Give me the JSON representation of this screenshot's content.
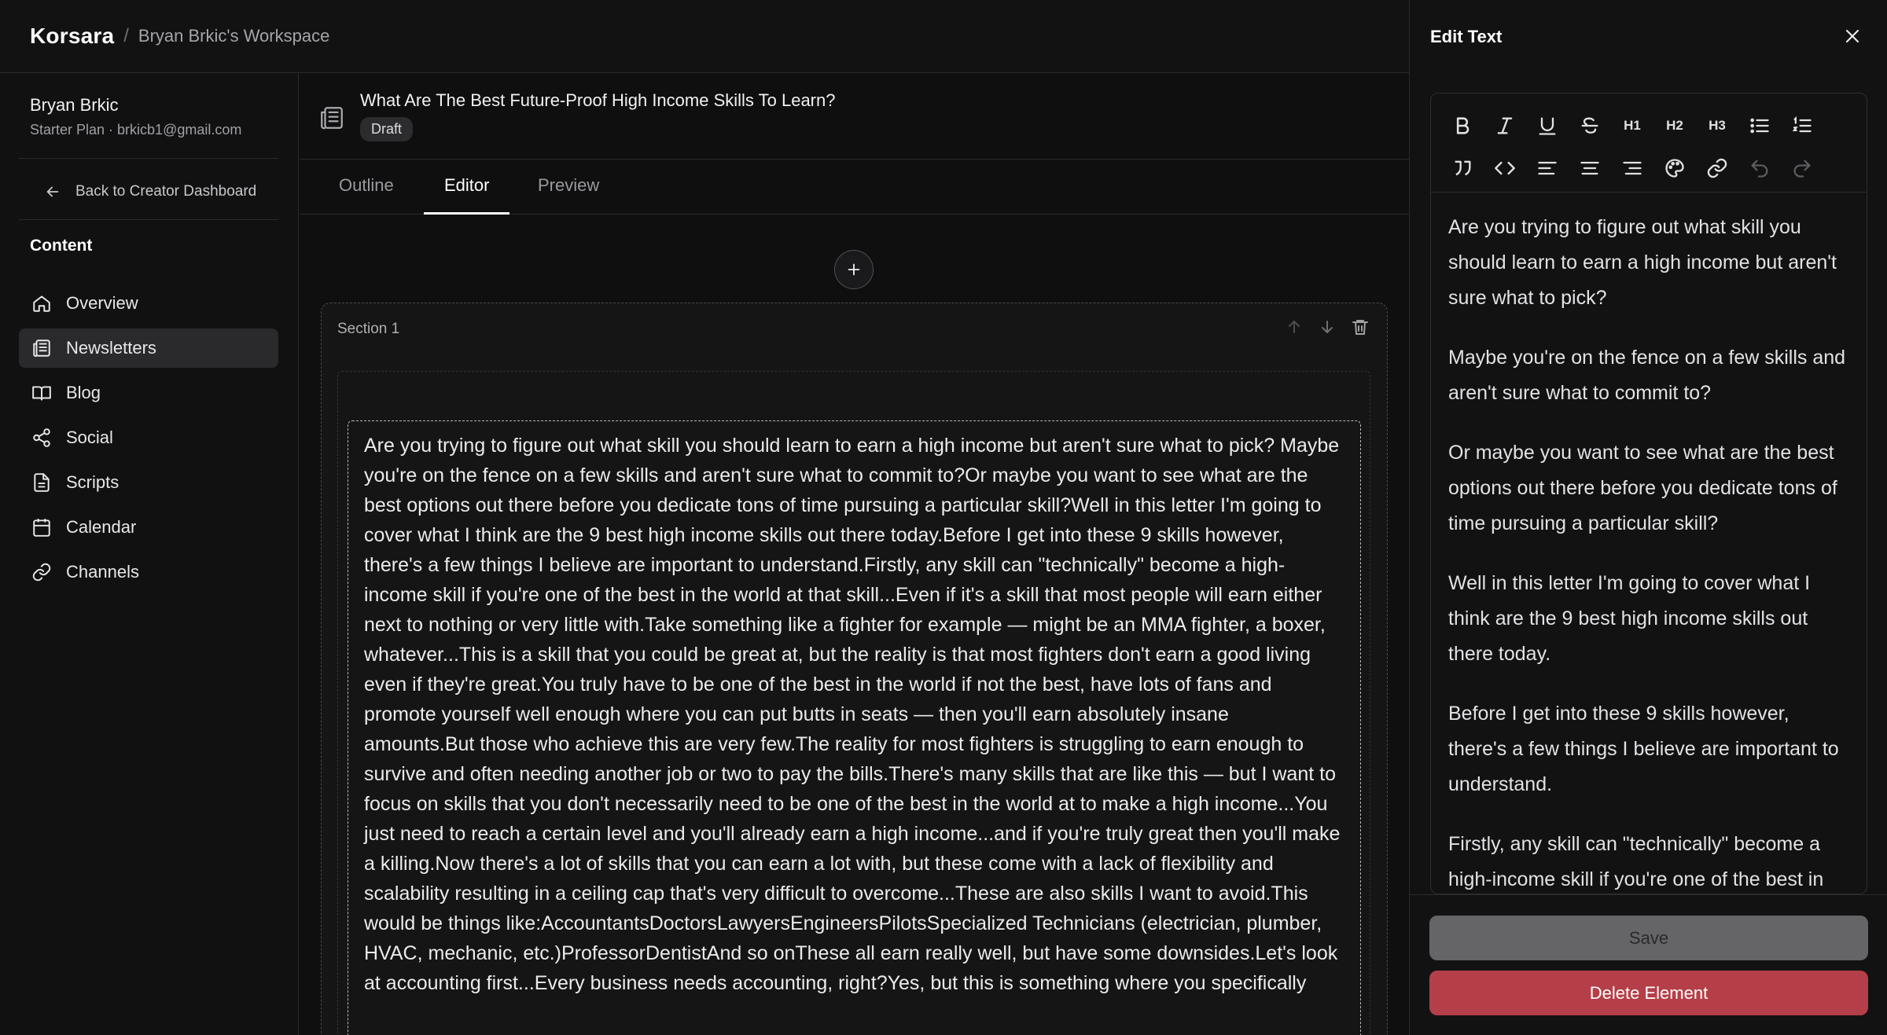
{
  "app": {
    "brand": "Korsara",
    "separator": "/",
    "workspace": "Bryan Brkic's Workspace"
  },
  "sidebar": {
    "user_name": "Bryan Brkic",
    "user_meta": "Starter Plan · brkicb1@gmail.com",
    "back_label": "Back to Creator Dashboard",
    "section_title": "Content",
    "items": [
      {
        "label": "Overview",
        "icon": "home-icon"
      },
      {
        "label": "Newsletters",
        "icon": "newspaper-icon",
        "active": true
      },
      {
        "label": "Blog",
        "icon": "book-icon"
      },
      {
        "label": "Social",
        "icon": "share-icon"
      },
      {
        "label": "Scripts",
        "icon": "file-text-icon"
      },
      {
        "label": "Calendar",
        "icon": "calendar-icon"
      },
      {
        "label": "Channels",
        "icon": "link-icon"
      }
    ]
  },
  "document": {
    "title": "What Are The Best Future-Proof High Income Skills To Learn?",
    "status": "Draft",
    "tabs": [
      "Outline",
      "Editor",
      "Preview"
    ],
    "active_tab": "Editor"
  },
  "section": {
    "label": "Section 1",
    "text": "Are you trying to figure out what skill you should learn to earn a high income but aren't sure what to pick? Maybe you're on the fence on a few skills and aren't sure what to commit to?Or maybe you want to see what are the best options out there before you dedicate tons of time pursuing a particular skill?Well in this letter I'm going to cover what I think are the 9 best high income skills out there today.Before I get into these 9 skills however, there's a few things I believe are important to understand.Firstly, any skill can \"technically\" become a high-income skill if you're one of the best in the world at that skill...Even if it's a skill that most people will earn either next to nothing or very little with.Take something like a fighter for example — might be an MMA fighter, a boxer, whatever...This is a skill that you could be great at, but the reality is that most fighters don't earn a good living even if they're great.You truly have to be one of the best in the world if not the best, have lots of fans and promote yourself well enough where you can put butts in seats — then you'll earn absolutely insane amounts.But those who achieve this are very few.The reality for most fighters is struggling to earn enough to survive and often needing another job or two to pay the bills.There's many skills that are like this — but I want to focus on skills that you don't necessarily need to be one of the best in the world at to make a high income...You just need to reach a certain level and you'll already earn a high income...and if you're truly great then you'll make a killing.Now there's a lot of skills that you can earn a lot with, but these come with a lack of flexibility and scalability resulting in a ceiling cap that's very difficult to overcome...These are also skills I want to avoid.This would be things like:AccountantsDoctorsLawyersEngineersPilotsSpecialized Technicians (electrician, plumber, HVAC, mechanic, etc.)ProfessorDentistAnd so onThese all earn really well, but have some downsides.Let's look at accounting first...Every business needs accounting, right?Yes, but this is something where you specifically"
  },
  "panel": {
    "title": "Edit Text",
    "paragraphs": [
      "Are you trying to figure out what skill you should learn to earn a high income but aren't sure what to pick?",
      "Maybe you're on the fence on a few skills and aren't sure what to commit to?",
      "Or maybe you want to see what are the best options out there before you dedicate tons of time pursuing a particular skill?",
      "Well in this letter I'm going to cover what I think are the 9 best high income skills out there today.",
      "Before I get into these 9 skills however, there's a few things I believe are important to understand.",
      "Firstly, any skill can \"technically\" become a high-income skill if you're one of the best in"
    ],
    "toolbar": {
      "h1": "H1",
      "h2": "H2",
      "h3": "H3",
      "row1": [
        "bold-icon",
        "italic-icon",
        "underline-icon",
        "strikethrough-icon",
        "heading-1-icon",
        "heading-2-icon",
        "heading-3-icon",
        "bullet-list-icon",
        "ordered-list-icon"
      ],
      "row2": [
        "blockquote-icon",
        "code-icon",
        "align-left-icon",
        "align-center-icon",
        "align-right-icon",
        "palette-icon",
        "link-icon",
        "undo-icon",
        "redo-icon"
      ]
    },
    "save_label": "Save",
    "delete_label": "Delete Element"
  },
  "colors": {
    "accent_danger": "#b43f48",
    "save_disabled": "#656568",
    "active_nav": "#2a2a2c"
  }
}
